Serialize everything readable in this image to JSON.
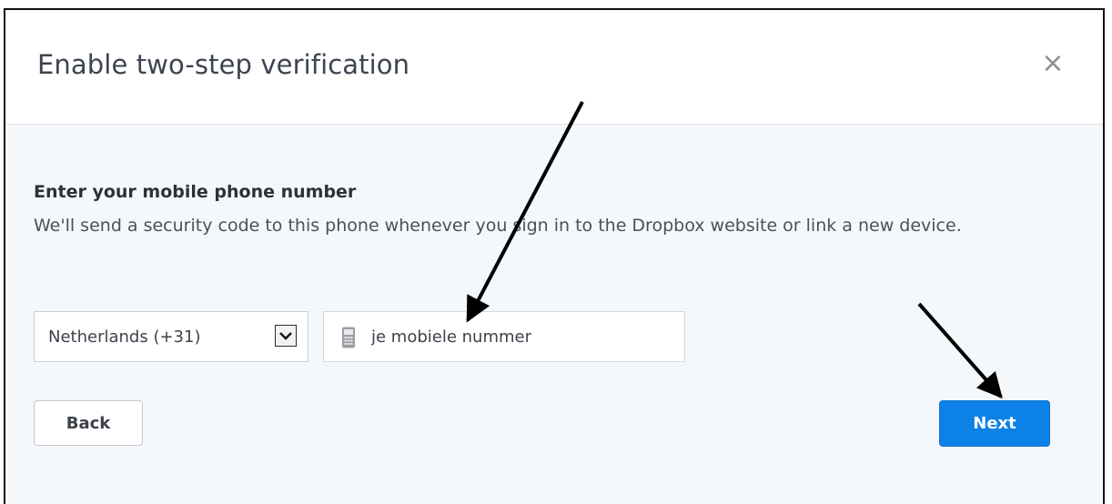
{
  "dialog": {
    "title": "Enable two-step verification",
    "close_symbol": "×",
    "close_icon": "close-icon"
  },
  "content": {
    "heading": "Enter your mobile phone number",
    "description": "We'll send a security code to this phone whenever you sign in to the Dropbox website or link a new device."
  },
  "country_select": {
    "selected": "Netherlands (+31)",
    "icon": "chevron-down-icon"
  },
  "phone_input": {
    "value": "",
    "placeholder": "je mobiele nummer",
    "icon": "mobile-phone-icon"
  },
  "buttons": {
    "back": "Back",
    "next": "Next"
  },
  "colors": {
    "primary": "#0d82e6",
    "body_bg": "#f5f8fb",
    "header_bg": "#ffffff",
    "annotation": "#000000"
  }
}
